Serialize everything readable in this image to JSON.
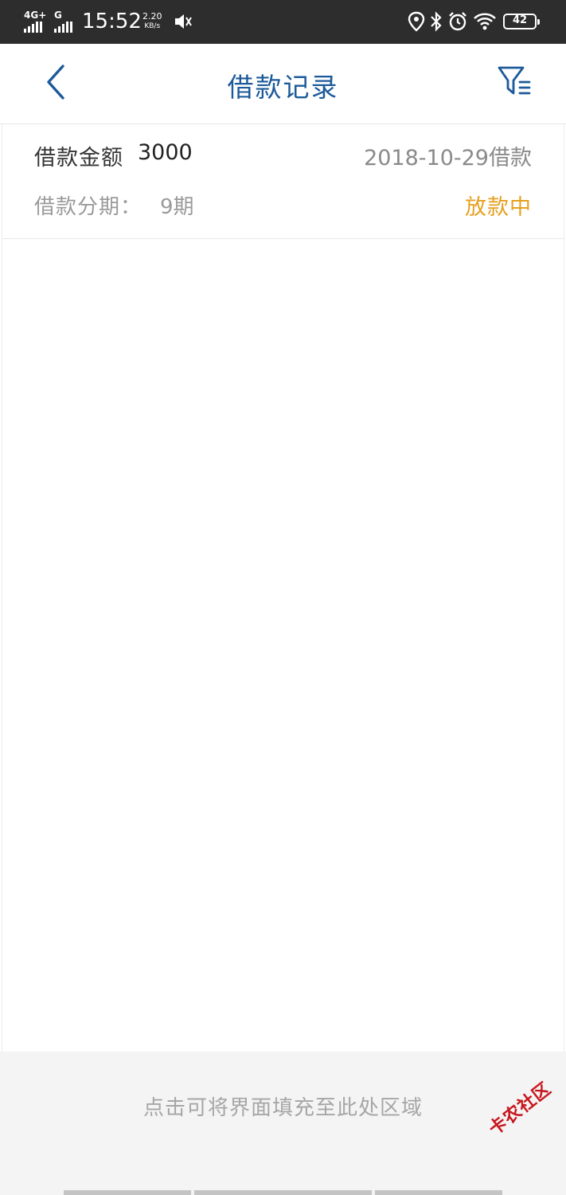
{
  "status_bar": {
    "network_primary": "4G+",
    "network_secondary": "G",
    "time": "15:52",
    "speed_value": "2.20",
    "speed_unit": "KB/s",
    "battery_level": "42",
    "icons": [
      "signal-icon",
      "mute-icon",
      "location-icon",
      "bluetooth-icon",
      "alarm-icon",
      "wifi-icon",
      "battery-icon"
    ]
  },
  "header": {
    "title": "借款记录",
    "back_icon": "chevron-left-icon",
    "filter_icon": "filter-icon"
  },
  "records": [
    {
      "amount_label": "借款金额",
      "amount": "3000",
      "date": "2018-10-29借款",
      "term_label": "借款分期：",
      "term": "9期",
      "status": "放款中"
    }
  ],
  "fill_area": {
    "hint": "点击可将界面填充至此处区域"
  },
  "watermark": {
    "text": "卡农社区"
  },
  "colors": {
    "title_blue": "#1d5a9a",
    "status_orange": "#e6a020",
    "status_bar_bg": "#2d2d2d"
  }
}
